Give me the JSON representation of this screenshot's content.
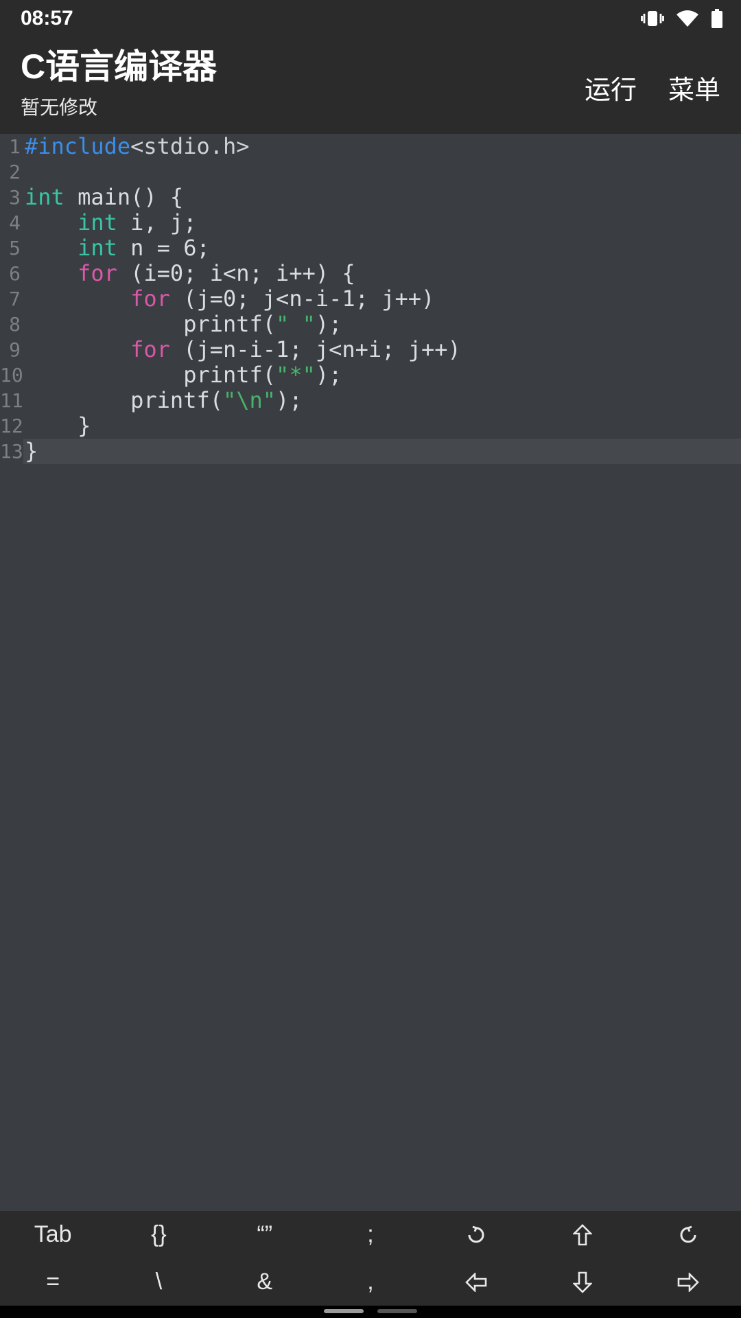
{
  "status": {
    "time": "08:57"
  },
  "header": {
    "title": "C语言编译器",
    "subtitle": "暂无修改",
    "run_label": "运行",
    "menu_label": "菜单"
  },
  "code": {
    "line_numbers": [
      "1",
      "2",
      "3",
      "4",
      "5",
      "6",
      "7",
      "8",
      "9",
      "10",
      "11",
      "12",
      "13"
    ],
    "current_line": 13,
    "lines": [
      [
        [
          "pre",
          "#include"
        ],
        [
          "inc",
          "<stdio.h>"
        ]
      ],
      [
        [
          "plain",
          ""
        ]
      ],
      [
        [
          "type",
          "int"
        ],
        [
          "plain",
          " main() {"
        ]
      ],
      [
        [
          "plain",
          "    "
        ],
        [
          "type",
          "int"
        ],
        [
          "plain",
          " i, j;"
        ]
      ],
      [
        [
          "plain",
          "    "
        ],
        [
          "type",
          "int"
        ],
        [
          "plain",
          " n = 6;"
        ]
      ],
      [
        [
          "plain",
          "    "
        ],
        [
          "kw",
          "for"
        ],
        [
          "plain",
          " (i=0; i<n; i++) {"
        ]
      ],
      [
        [
          "plain",
          "        "
        ],
        [
          "kw",
          "for"
        ],
        [
          "plain",
          " (j=0; j<n-i-1; j++)"
        ]
      ],
      [
        [
          "plain",
          "            printf("
        ],
        [
          "str",
          "\" \""
        ],
        [
          "plain",
          ");"
        ]
      ],
      [
        [
          "plain",
          "        "
        ],
        [
          "kw",
          "for"
        ],
        [
          "plain",
          " (j=n-i-1; j<n+i; j++)"
        ]
      ],
      [
        [
          "plain",
          "            printf("
        ],
        [
          "str",
          "\"*\""
        ],
        [
          "plain",
          ");"
        ]
      ],
      [
        [
          "plain",
          "        printf("
        ],
        [
          "str",
          "\"\\n\""
        ],
        [
          "plain",
          ");"
        ]
      ],
      [
        [
          "plain",
          "    }"
        ]
      ],
      [
        [
          "plain",
          "}"
        ]
      ]
    ]
  },
  "toolbar": {
    "row1": {
      "tab": "Tab",
      "braces": "{}",
      "quotes": "“”",
      "semicolon": ";"
    },
    "row2": {
      "equals": "=",
      "backslash": "\\",
      "ampersand": "&",
      "comma": ","
    }
  }
}
